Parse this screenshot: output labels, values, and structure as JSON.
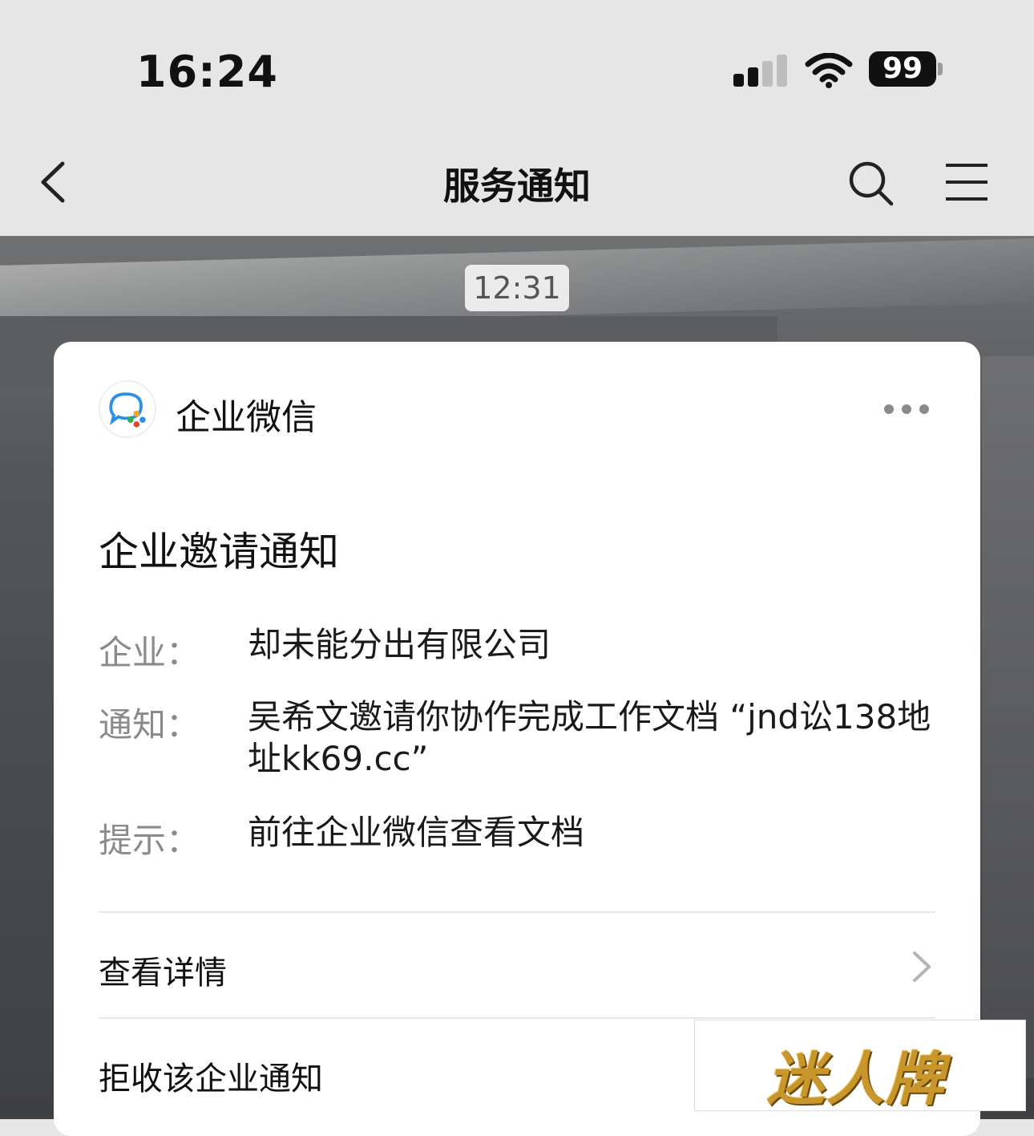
{
  "status_bar": {
    "time": "16:24",
    "battery": "99"
  },
  "nav": {
    "title": "服务通知"
  },
  "timestamp": "12:31",
  "card": {
    "app_name": "企业微信",
    "title": "企业邀请通知",
    "fields": [
      {
        "label": "企业：",
        "value": "却未能分出有限公司"
      },
      {
        "label": "通知：",
        "value": "吴希文邀请你协作完成工作文档 “jnd讼138地址kk69.cc”"
      },
      {
        "label": "提示：",
        "value": "前往企业微信查看文档"
      }
    ],
    "actions": {
      "view_details": "查看详情",
      "reject": "拒收该企业通知"
    }
  },
  "watermark": "迷人牌",
  "colors": {
    "nav_bg": "#e6e6e6",
    "card_bg": "#ffffff",
    "label_gray": "#8a8a8a"
  }
}
